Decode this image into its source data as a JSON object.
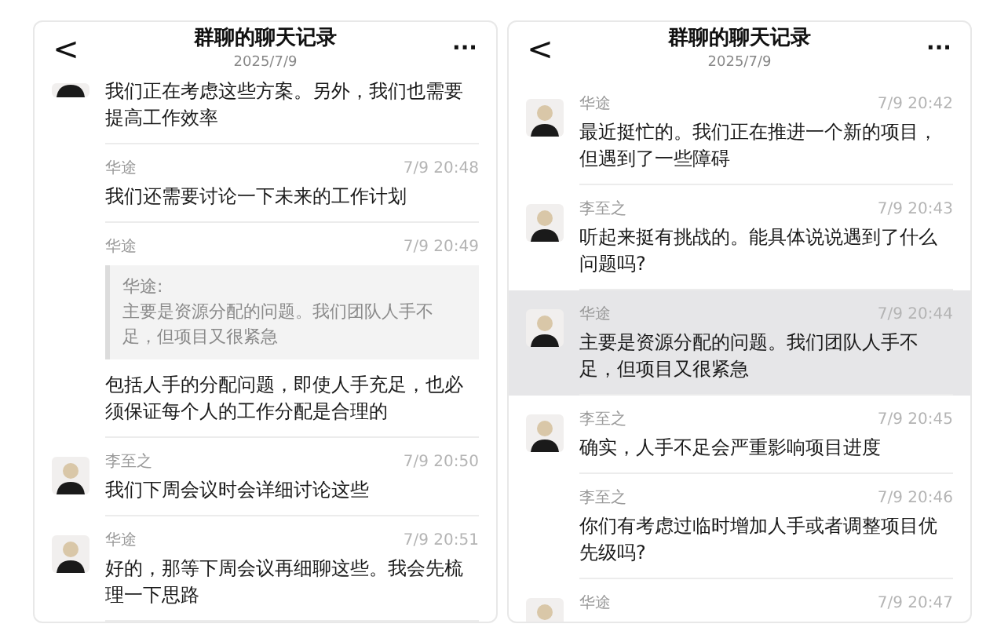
{
  "panels": [
    {
      "title": "群聊的聊天记录",
      "date": "2025/7/9",
      "back_icon": "<",
      "menu_icon": "···",
      "messages": [
        {
          "avatar": true,
          "text": "我们正在考虑这些方案。另外，我们也需要提高工作效率",
          "selected": false
        },
        {
          "avatar": false,
          "sender": "华途",
          "time": "7/9 20:48",
          "text": "我们还需要讨论一下未来的工作计划",
          "selected": false
        },
        {
          "avatar": false,
          "sender": "华途",
          "time": "7/9 20:49",
          "quote": {
            "sender": "华途:",
            "text": "主要是资源分配的问题。我们团队人手不足，但项目又很紧急"
          },
          "text": "包括人手的分配问题，即使人手充足，也必须保证每个人的工作分配是合理的",
          "selected": false
        },
        {
          "avatar": true,
          "sender": "李至之",
          "time": "7/9 20:50",
          "text": "我们下周会议时会详细讨论这些",
          "selected": false
        },
        {
          "avatar": true,
          "sender": "华途",
          "time": "7/9 20:51",
          "text": "好的，那等下周会议再细聊这些。我会先梳理一下思路",
          "selected": false
        }
      ]
    },
    {
      "title": "群聊的聊天记录",
      "date": "2025/7/9",
      "back_icon": "<",
      "menu_icon": "···",
      "messages": [
        {
          "avatar": true,
          "sender": "华途",
          "time": "7/9 20:42",
          "text": "最近挺忙的。我们正在推进一个新的项目，但遇到了一些障碍",
          "selected": false
        },
        {
          "avatar": true,
          "sender": "李至之",
          "time": "7/9 20:43",
          "text": "听起来挺有挑战的。能具体说说遇到了什么问题吗?",
          "selected": false
        },
        {
          "avatar": true,
          "sender": "华途",
          "time": "7/9 20:44",
          "text": "主要是资源分配的问题。我们团队人手不足，但项目又很紧急",
          "selected": true
        },
        {
          "avatar": true,
          "sender": "李至之",
          "time": "7/9 20:45",
          "text": "确实，人手不足会严重影响项目进度",
          "selected": false
        },
        {
          "avatar": false,
          "sender": "李至之",
          "time": "7/9 20:46",
          "text": "你们有考虑过临时增加人手或者调整项目优先级吗?",
          "selected": false
        },
        {
          "avatar": true,
          "sender": "华途",
          "time": "7/9 20:47",
          "selected": false
        }
      ]
    }
  ]
}
